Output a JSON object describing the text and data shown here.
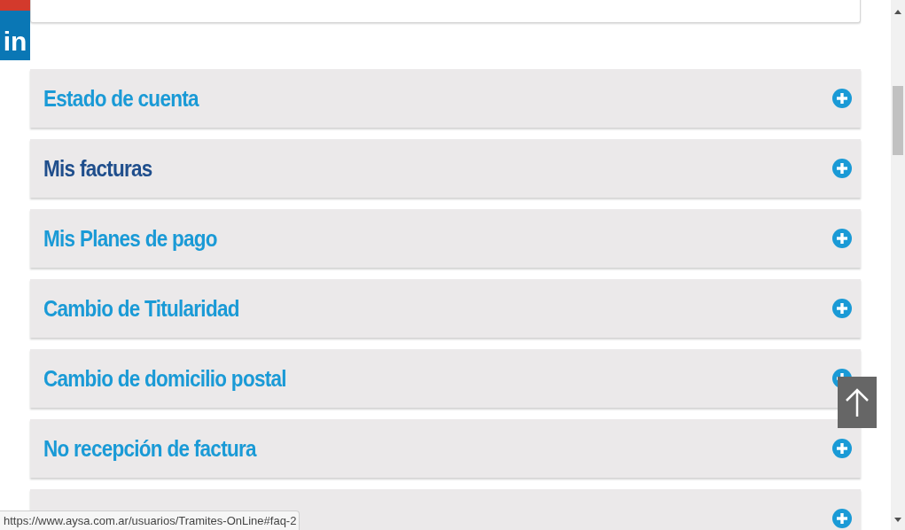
{
  "faq_items": [
    {
      "kind": "faq",
      "title": "Estado de cuenta",
      "highlighted": false
    },
    {
      "kind": "faq",
      "title": "Mis facturas",
      "highlighted": true
    },
    {
      "kind": "faq",
      "title": "Mis Planes de pago",
      "highlighted": false
    },
    {
      "kind": "faq",
      "title": "Cambio de Titularidad",
      "highlighted": false
    },
    {
      "kind": "faq",
      "title": "Cambio de domicilio postal",
      "highlighted": false
    },
    {
      "kind": "faq",
      "title": "No recepción de factura",
      "highlighted": false
    },
    {
      "kind": "cut-off"
    }
  ],
  "social": {
    "label": "in"
  },
  "status_bar": {
    "url": "https://www.aysa.com.ar/usuarios/Tramites-OnLine#faq-2"
  }
}
